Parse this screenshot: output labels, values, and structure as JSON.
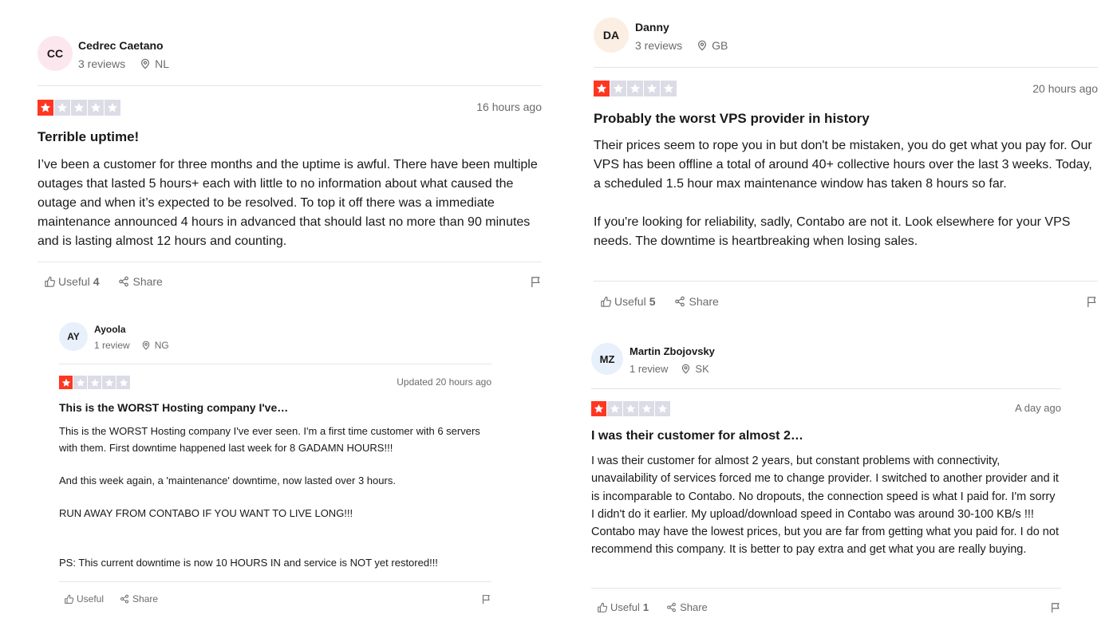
{
  "colors": {
    "star_filled": "#ff3722",
    "star_empty": "#dcdce6",
    "divider": "#e5e5dd",
    "muted": "#6b6b6b"
  },
  "reviews": [
    {
      "initials": "CC",
      "avatar_color": "#fde7ef",
      "name": "Cedrec Caetano",
      "reviews_count": "3 reviews",
      "country": "NL",
      "rating": 1,
      "date": "16 hours ago",
      "title": "Terrible uptime!",
      "body": [
        "I’ve been a customer for three months and the uptime is awful. There have been multiple outages that lasted 5 hours+ each with little to no information about what caused the outage and when it’s expected to be resolved. To top it off there was a immediate maintenance announced 4 hours in advanced that should last no more than 90 minutes and is lasting almost 12 hours and counting."
      ],
      "useful_label": "Useful",
      "useful_count": "4",
      "share_label": "Share"
    },
    {
      "initials": "AY",
      "avatar_color": "#e8f0fb",
      "name": "Ayoola",
      "reviews_count": "1 review",
      "country": "NG",
      "rating": 1,
      "date": "Updated 20 hours ago",
      "title": "This is the WORST Hosting company I've…",
      "body": [
        "This is the WORST Hosting company I've ever seen. I'm a first time customer with 6 servers with them. First downtime happened last week for 8 GADAMN HOURS!!!",
        "And this week again, a 'maintenance' downtime, now lasted over 3 hours.",
        "RUN AWAY FROM CONTABO IF YOU WANT TO LIVE LONG!!!",
        "",
        "PS: This current downtime is now 10 HOURS IN and service is NOT yet restored!!!"
      ],
      "useful_label": "Useful",
      "useful_count": "",
      "share_label": "Share"
    },
    {
      "initials": "DA",
      "avatar_color": "#fbeee3",
      "name": "Danny",
      "reviews_count": "3 reviews",
      "country": "GB",
      "rating": 1,
      "date": "20 hours ago",
      "title": "Probably the worst VPS provider in history",
      "body": [
        "Their prices seem to rope you in but don't be mistaken, you do get what you pay for. Our VPS has been offline a total of around 40+ collective hours over the last 3 weeks. Today, a scheduled 1.5 hour max maintenance window has taken 8 hours so far.",
        "If you're looking for reliability, sadly, Contabo are not it. Look elsewhere for your VPS needs. The downtime is heartbreaking when losing sales."
      ],
      "useful_label": "Useful",
      "useful_count": "5",
      "share_label": "Share"
    },
    {
      "initials": "MZ",
      "avatar_color": "#e8f0fb",
      "name": "Martin Zbojovsky",
      "reviews_count": "1 review",
      "country": "SK",
      "rating": 1,
      "date": "A day ago",
      "title": "I was their customer for almost 2…",
      "body": [
        "I was their customer for almost 2 years, but constant problems with connectivity, unavailability of services forced me to change provider. I switched to another provider and it is incomparable to Contabo. No dropouts, the connection speed is what I paid for. I'm sorry I didn't do it earlier. My upload/download speed in Contabo was around 30-100 KB/s !!! Contabo may have the lowest prices, but you are far from getting what you paid for. I do not recommend this company. It is better to pay extra and get what you are really buying."
      ],
      "useful_label": "Useful",
      "useful_count": "1",
      "share_label": "Share"
    }
  ]
}
